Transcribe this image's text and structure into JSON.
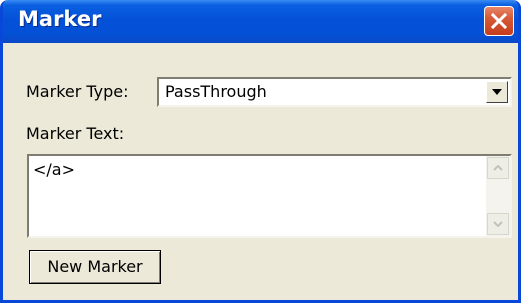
{
  "window": {
    "title": "Marker"
  },
  "marker_type": {
    "label": "Marker Type:",
    "selected": "PassThrough"
  },
  "marker_text": {
    "label": "Marker Text:",
    "value": "</a>"
  },
  "buttons": {
    "new_marker": "New Marker"
  },
  "icons": {
    "close": "close-icon",
    "dropdown": "chevron-down-icon",
    "scroll_up": "scroll-up-arrow-icon",
    "scroll_down": "scroll-down-arrow-icon"
  },
  "colors": {
    "titlebar": "#0451d8",
    "close_button": "#d65a36",
    "window_bg": "#ece9d8"
  }
}
